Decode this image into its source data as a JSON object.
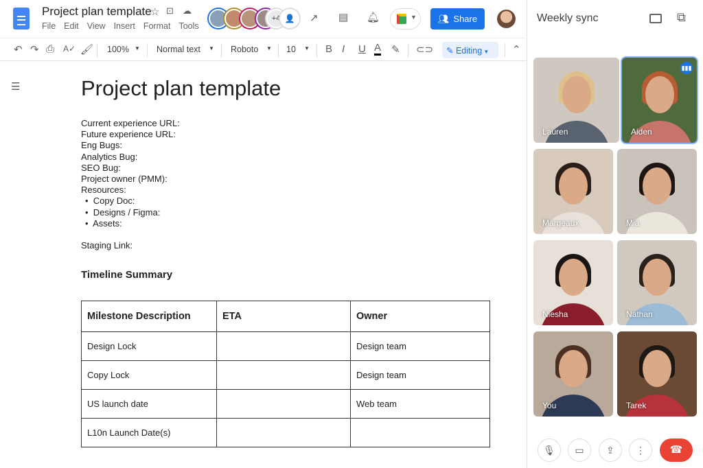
{
  "docs": {
    "title": "Project plan template",
    "menu": [
      "File",
      "Edit",
      "View",
      "Insert",
      "Format",
      "Tools"
    ],
    "collaborators_more": "+4",
    "share_label": "Share",
    "toolbar": {
      "zoom": "100%",
      "style": "Normal text",
      "font": "Roboto",
      "size": "10",
      "mode": "Editing"
    },
    "body": {
      "heading": "Project plan template",
      "lines": [
        "Current experience URL:",
        "Future experience URL:",
        "Eng Bugs:",
        "Analytics Bug:",
        "SEO Bug:",
        "Project owner (PMM):",
        "Resources:"
      ],
      "bullets": [
        "Copy Doc:",
        "Designs / Figma:",
        "Assets:"
      ],
      "staging": "Staging Link:",
      "section": "Timeline Summary",
      "table": {
        "headers": [
          "Milestone Description",
          "ETA",
          "Owner"
        ],
        "rows": [
          [
            "Design Lock",
            "",
            "Design team"
          ],
          [
            "Copy Lock",
            "",
            "Design team"
          ],
          [
            "US launch date",
            "",
            "Web team"
          ],
          [
            "L10n Launch Date(s)",
            "",
            ""
          ]
        ]
      }
    }
  },
  "meet": {
    "title": "Weekly sync",
    "participants": [
      {
        "name": "Lauren",
        "bg": "#cfc8c0",
        "shirt": "#5a6470",
        "hair": "#e0c08a",
        "speaking": false
      },
      {
        "name": "Aiden",
        "bg": "#4f6a3c",
        "shirt": "#c7746a",
        "hair": "#b85d33",
        "speaking": true
      },
      {
        "name": "Margeaux",
        "bg": "#d8cbbd",
        "shirt": "#e8e2da",
        "hair": "#2b1e18",
        "speaking": false
      },
      {
        "name": "Mia",
        "bg": "#c9c3bc",
        "shirt": "#ebe6dc",
        "hair": "#1c1512",
        "speaking": false
      },
      {
        "name": "Niesha",
        "bg": "#e6e0d8",
        "shirt": "#8a1e2a",
        "hair": "#1a1412",
        "speaking": false
      },
      {
        "name": "Nathan",
        "bg": "#cfc9c0",
        "shirt": "#9bbbd6",
        "hair": "#2a211b",
        "speaking": false
      },
      {
        "name": "You",
        "bg": "#b9a99a",
        "shirt": "#2c3a55",
        "hair": "#4a2f22",
        "speaking": false
      },
      {
        "name": "Tarek",
        "bg": "#6b4a35",
        "shirt": "#b8323a",
        "hair": "#1e1814",
        "speaking": false
      }
    ]
  },
  "colors": {
    "accent": "#1a73e8",
    "end_call": "#ea4335"
  }
}
